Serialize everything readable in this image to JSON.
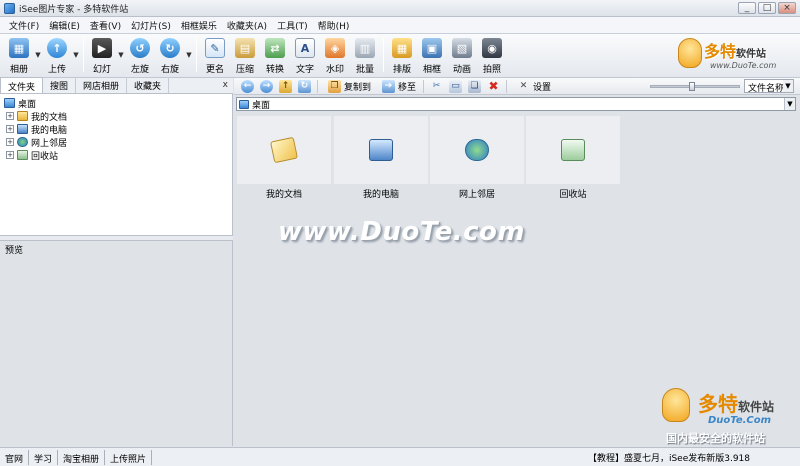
{
  "window": {
    "title": "iSee图片专家 - 多特软件站",
    "minimize": "_",
    "maximize": "□",
    "close": "×"
  },
  "menu": [
    "文件(F)",
    "编辑(E)",
    "查看(V)",
    "幻灯片(S)",
    "相框娱乐",
    "收藏夹(A)",
    "工具(T)",
    "帮助(H)"
  ],
  "toolbar": {
    "album": "相册",
    "upload": "上传",
    "slideshow": "幻灯",
    "rotate_left": "左旋",
    "rotate_right": "右旋",
    "rename": "更名",
    "compress": "压缩",
    "convert": "转换",
    "text": "文字",
    "watermark": "水印",
    "batch": "批量",
    "layout": "排版",
    "frame": "相框",
    "animation": "动画",
    "photo": "拍照"
  },
  "logo": {
    "brand": "多特",
    "brand_suffix": "软件站",
    "url": "www.DuoTe.com"
  },
  "left_tabs": [
    "文件夹",
    "搜图",
    "网店相册",
    "收藏夹"
  ],
  "pane_close": "x",
  "tree": {
    "root": "桌面",
    "items": [
      {
        "label": "我的文档",
        "icon": "my-documents-icon"
      },
      {
        "label": "我的电脑",
        "icon": "my-computer-icon"
      },
      {
        "label": "网上邻居",
        "icon": "network-icon"
      },
      {
        "label": "回收站",
        "icon": "recycle-bin-icon"
      }
    ]
  },
  "preview_label": "预览",
  "nav": {
    "copy_to": "复制到",
    "move_to": "移至",
    "settings": "设置",
    "sort": "文件名称"
  },
  "address": "桌面",
  "thumbnails": [
    "我的文档",
    "我的电脑",
    "网上邻居",
    "回收站"
  ],
  "watermark": "www.DuoTe.com",
  "bottom_logo": {
    "brand": "多特",
    "brand_suffix": "软件站",
    "url": "DuoTe.Com",
    "slogan": "国内最安全的软件站"
  },
  "status": {
    "items": [
      "官网",
      "学习",
      "淘宝相册",
      "上传照片"
    ],
    "news": "【教程】盛夏七月，iSee发布新版3.918"
  },
  "colors": {
    "accent": "#e58a00",
    "panel": "#dfe3e8"
  }
}
